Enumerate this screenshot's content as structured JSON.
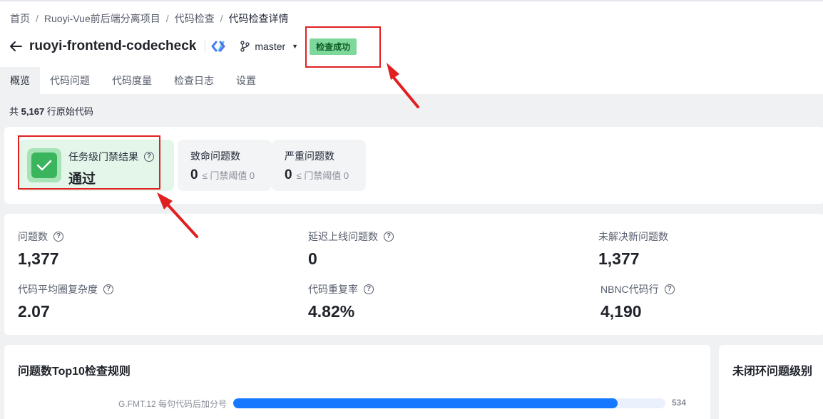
{
  "breadcrumb": [
    "首页",
    "Ruoyi-Vue前后端分离项目",
    "代码检查",
    "代码检查详情"
  ],
  "header": {
    "project_name": "ruoyi-frontend-codecheck",
    "branch": "master",
    "status": "检查成功"
  },
  "tabs": [
    "概览",
    "代码问题",
    "代码度量",
    "检查日志",
    "设置"
  ],
  "summary": {
    "prefix": "共",
    "lines": "5,167",
    "suffix": "行原始代码"
  },
  "gate": {
    "label": "任务级门禁结果",
    "result": "通过",
    "fatal": {
      "label": "致命问题数",
      "value": "0",
      "threshold": "≤ 门禁阈值 0"
    },
    "serious": {
      "label": "严重问题数",
      "value": "0",
      "threshold": "≤ 门禁阈值 0"
    }
  },
  "metrics": [
    {
      "label": "问题数",
      "value": "1,377",
      "help": true
    },
    {
      "label": "延迟上线问题数",
      "value": "0",
      "help": true
    },
    {
      "label": "未解决新问题数",
      "value": "1,377",
      "help": false
    },
    {
      "label": "代码平均圈复杂度",
      "value": "2.07",
      "help": true
    },
    {
      "label": "代码重复率",
      "value": "4.82%",
      "help": true
    },
    {
      "label": "NBNC代码行",
      "value": "4,190",
      "help": true
    }
  ],
  "top10": {
    "title": "问题数Top10检查规则",
    "rules": [
      {
        "label": "G.FMT.12 每句代码后加分号",
        "count": 534,
        "fraction": 0.89
      }
    ]
  },
  "level_card": {
    "title": "未闭环问题级别"
  },
  "colors": {
    "accent": "#1677ff",
    "success_badge": "#7fd89b",
    "gate_pass": "#3bb45e",
    "annotation": "#e02020"
  }
}
